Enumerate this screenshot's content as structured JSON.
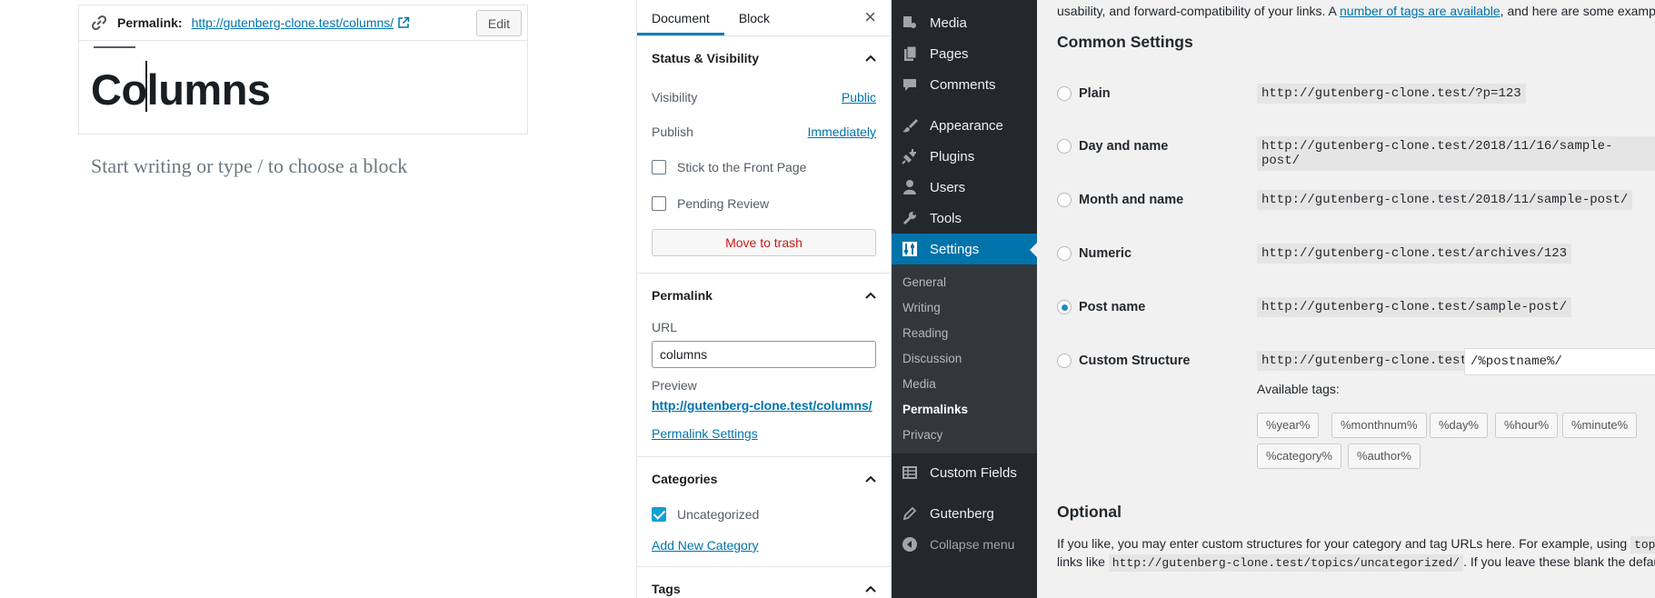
{
  "editor": {
    "permalink_label": "Permalink:",
    "permalink_url": "http://gutenberg-clone.test/columns/",
    "edit_label": "Edit",
    "post_title": "Columns",
    "placeholder": "Start writing or type / to choose a block"
  },
  "sidebar": {
    "tabs": [
      "Document",
      "Block"
    ],
    "close_glyph": "×",
    "status": {
      "heading": "Status & Visibility",
      "visibility_label": "Visibility",
      "visibility_value": "Public",
      "publish_label": "Publish",
      "publish_value": "Immediately",
      "sticky_label": "Stick to the Front Page",
      "pending_label": "Pending Review",
      "trash_label": "Move to trash"
    },
    "permalink": {
      "heading": "Permalink",
      "url_label": "URL",
      "url_value": "columns",
      "preview_label": "Preview",
      "preview_prefix": "http://gutenberg-clone.test/",
      "preview_slug": "columns/",
      "settings_link": "Permalink Settings"
    },
    "categories": {
      "heading": "Categories",
      "items": [
        "Uncategorized"
      ],
      "add_link": "Add New Category"
    },
    "tags": {
      "heading": "Tags"
    }
  },
  "admin_menu": {
    "items": [
      "Media",
      "Pages",
      "Comments",
      "Appearance",
      "Plugins",
      "Users",
      "Tools",
      "Settings"
    ],
    "settings_sub": [
      "General",
      "Writing",
      "Reading",
      "Discussion",
      "Media",
      "Permalinks",
      "Privacy"
    ],
    "after": [
      "Custom Fields",
      "Gutenberg"
    ],
    "collapse": "Collapse menu"
  },
  "settings_page": {
    "intro_text": "usability, and forward-compatibility of your links. A ",
    "intro_link": "number of tags are available",
    "intro_tail": ", and here are some examples",
    "common_heading": "Common Settings",
    "options": [
      {
        "label": "Plain",
        "example": "http://gutenberg-clone.test/?p=123"
      },
      {
        "label": "Day and name",
        "example": "http://gutenberg-clone.test/2018/11/16/sample-post/"
      },
      {
        "label": "Month and name",
        "example": "http://gutenberg-clone.test/2018/11/sample-post/"
      },
      {
        "label": "Numeric",
        "example": "http://gutenberg-clone.test/archives/123"
      },
      {
        "label": "Post name",
        "example": "http://gutenberg-clone.test/sample-post/"
      },
      {
        "label": "Custom Structure",
        "example": "http://gutenberg-clone.test"
      }
    ],
    "selected_option": "Post name",
    "custom_structure_value": "/%postname%/",
    "available_tags_label": "Available tags:",
    "tags": [
      "%year%",
      "%monthnum%",
      "%day%",
      "%hour%",
      "%minute%",
      "%category%",
      "%author%"
    ],
    "optional_heading": "Optional",
    "optional_line1": "If you like, you may enter custom structures for your category and tag URLs here. For example, using ",
    "optional_code1": "topic",
    "optional_line2_a": "links like ",
    "optional_code2": "http://gutenberg-clone.test/topics/uncategorized/",
    "optional_line2_b": ". If you leave these blank the defau"
  }
}
